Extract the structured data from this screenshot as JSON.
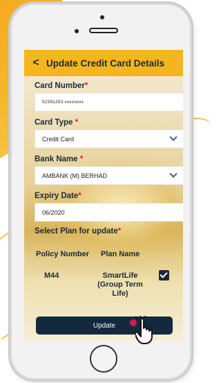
{
  "header": {
    "title": "Update Credit Card Details"
  },
  "form": {
    "card_number": {
      "label": "Card Number",
      "required_mark": "*",
      "value": "52391253 xxxxxxxx"
    },
    "card_type": {
      "label": "Card Type ",
      "required_mark": "*",
      "value": "Credit Card"
    },
    "bank_name": {
      "label": "Bank Name ",
      "required_mark": "*",
      "value": "AMBANK (M) BERHAD"
    },
    "expiry_date": {
      "label": "Expiry Date",
      "required_mark": "*",
      "value": "06/2020"
    },
    "plan_section": {
      "label": "Select Plan for update",
      "required_mark": "*"
    }
  },
  "plans_table": {
    "columns": [
      "Policy Number",
      "Plan Name"
    ],
    "rows": [
      {
        "policy_number": "M44",
        "plan_name": "SmartLife (Group Term Life)",
        "checked": true
      }
    ]
  },
  "update_button_label": "Update",
  "colors": {
    "header_bg": "#f5b51e",
    "button_bg": "#13293d",
    "required": "#e02020",
    "tap_indicator": "#d21c4a"
  },
  "icons": [
    "back-arrow-icon",
    "chevron-down-icon",
    "checkbox-checked-icon",
    "hand-pointer-icon"
  ]
}
